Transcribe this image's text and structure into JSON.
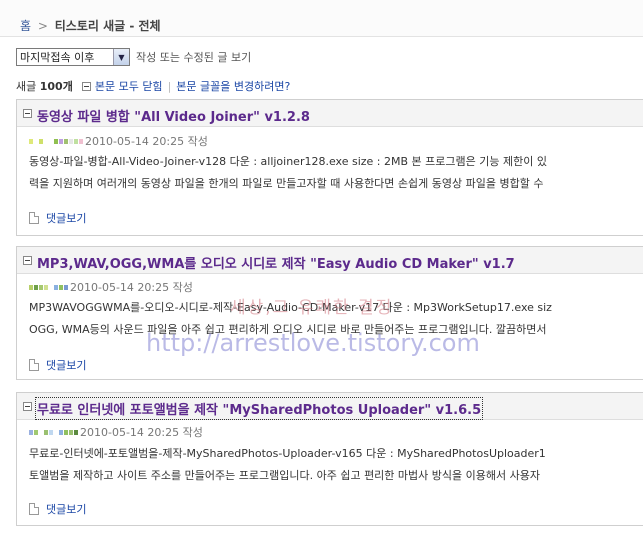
{
  "breadcrumb": {
    "home": "홈",
    "separator": ">",
    "title": "티스토리 새글 - 전체"
  },
  "filter": {
    "selected": "마지막접속 이후",
    "description": "작성 또는 수정된 글 보기"
  },
  "summary": {
    "count_prefix": "새글",
    "count": "100개",
    "collapse_all": "본문 모두 닫힘",
    "change_font": "본문 글꼴을 변경하려면?"
  },
  "posts": [
    {
      "title": "동영상 파일 병합 \"All Video Joiner\" v1.2.8",
      "meta": "2010-05-14 20:25 작성",
      "line1": "동영상-파일-병합-All-Video-Joiner-v128 다운 : alljoiner128.exe size : 2MB 본 프로그램은 기능 제한이 있",
      "line2": "력을 지원하며 여러개의 동영상 파일을 한개의 파일로 만들고자할 때 사용한다면 손쉽게 동영상 파일을 병합할 수",
      "comments": "댓글보기"
    },
    {
      "title": "MP3,WAV,OGG,WMA를 오디오 시디로 제작 \"Easy Audio CD Maker\" v1.7",
      "meta": "2010-05-14 20:25 작성",
      "line1": "MP3WAVOGGWMA를-오디오-시디로-제작-Easy-Audio-CD-Maker-v17 다운 : Mp3WorkSetup17.exe siz",
      "line2": "OGG, WMA등의 사운드 파일을 아주 쉽고 편리하게 오디오 시디로 바로 만들어주는 프로그램입니다. 깔끔하면서",
      "comments": "댓글보기"
    },
    {
      "title": "무료로 인터넷에 포토앨범을 제작 \"MySharedPhotos Uploader\" v1.6.5",
      "meta": "2010-05-14 20:25 작성",
      "line1": "무료로-인터넷에-포토앨범을-제작-MySharedPhotos-Uploader-v165 다운 : MySharedPhotosUploader1",
      "line2": "토앨범을 제작하고 사이트 주소를 만들어주는 프로그램입니다. 아주 쉽고 편리한 마법사 방식을 이용해서 사용자",
      "comments": "댓글보기"
    }
  ],
  "watermark": {
    "line1": "세상,그 유쾌한 결정",
    "line2": "http://arrestlove.tistory.com"
  },
  "colors": {
    "title": "#5c2a8c",
    "link": "#1a46a5"
  }
}
